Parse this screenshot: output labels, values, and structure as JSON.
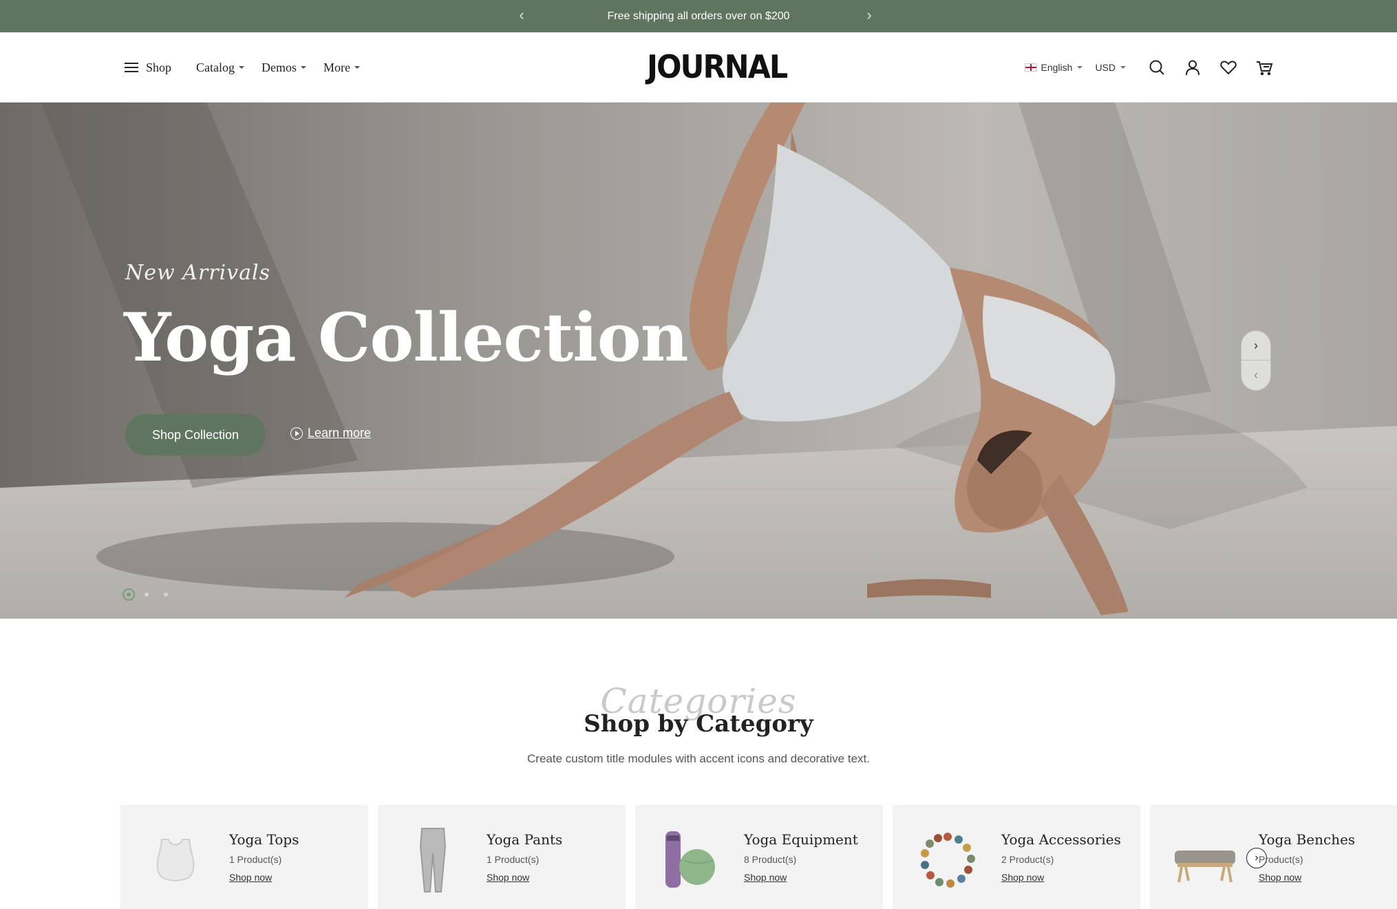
{
  "announcement": {
    "message": "Free shipping all orders over on $200",
    "prev_icon": "‹",
    "next_icon": "›"
  },
  "header": {
    "menu": [
      {
        "label": "Shop"
      },
      {
        "label": "Catalog"
      },
      {
        "label": "Demos"
      },
      {
        "label": "More"
      }
    ],
    "logo": "JOURNAL",
    "language": "English",
    "currency": "USD",
    "icons": [
      "search-icon",
      "account-icon",
      "wishlist-icon",
      "cart-icon"
    ]
  },
  "hero": {
    "kicker": "New Arrivals",
    "title": "Yoga Collection",
    "cta_label": "Shop Collection",
    "learn_label": "Learn more",
    "next_icon": "›",
    "prev_icon": "‹"
  },
  "categories": {
    "accent": "Categories",
    "title": "Shop by Category",
    "subtitle": "Create custom title modules with accent icons and decorative text.",
    "next_icon": "›",
    "items": [
      {
        "name": "Yoga Tops",
        "count": "1   Product(s)",
        "link": "Shop now",
        "icon": "yoga-top-icon"
      },
      {
        "name": "Yoga Pants",
        "count": "1   Product(s)",
        "link": "Shop now",
        "icon": "yoga-pants-icon"
      },
      {
        "name": "Yoga Equipment",
        "count": "8   Product(s)",
        "link": "Shop now",
        "icon": "yoga-mat-icon"
      },
      {
        "name": "Yoga Accessories",
        "count": "2   Product(s)",
        "link": "Shop now",
        "icon": "bead-bracelet-icon"
      },
      {
        "name": "Yoga Benches",
        "count": "Product(s)",
        "link": "Shop now",
        "icon": "bench-icon"
      }
    ]
  },
  "colors": {
    "brand_green": "#5f7560",
    "card_bg": "#f4f3f3"
  }
}
